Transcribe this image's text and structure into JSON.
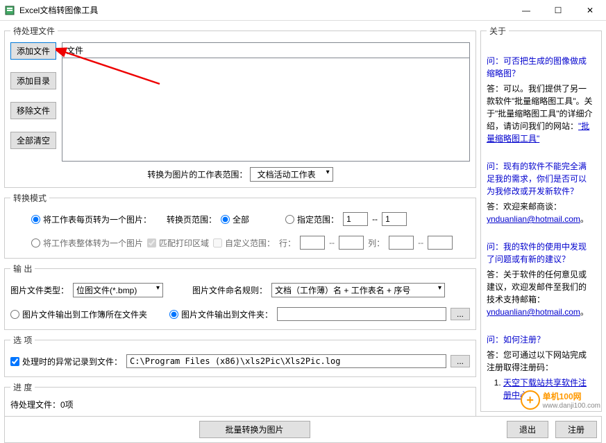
{
  "window": {
    "title": "Excel文档转图像工具",
    "min": "—",
    "max": "☐",
    "close": "✕"
  },
  "pending": {
    "legend": "待处理文件",
    "add_file": "添加文件",
    "add_dir": "添加目录",
    "remove": "移除文件",
    "clear": "全部清空",
    "col_header": "文件",
    "range_label": "转换为图片的工作表范围：",
    "range_select": "文档活动工作表"
  },
  "mode": {
    "legend": "转换模式",
    "each_page": "将工作表每页转为一个图片：",
    "page_range_label": "转换页范围：",
    "page_all": "全部",
    "page_range": "指定范围：",
    "page_from": "1",
    "page_sep": "--",
    "page_to": "1",
    "whole_sheet": "将工作表整体转为一个图片",
    "match_print": "匹配打印区域",
    "custom_range": "自定义范围：",
    "row_label": "行：",
    "col_label": "列：",
    "dash": "--"
  },
  "output": {
    "legend": "输 出",
    "type_label": "图片文件类型：",
    "type_select": "位图文件(*.bmp)",
    "naming_label": "图片文件命名规则：",
    "naming_select": "文档（工作薄）名 + 工作表名 + 序号",
    "to_workbook_dir": "图片文件输出到工作簿所在文件夹",
    "to_folder": "图片文件输出到文件夹：",
    "folder_path": "",
    "browse": "..."
  },
  "options": {
    "legend": "选  项",
    "log_label": "处理时的异常记录到文件：",
    "log_path": "C:\\Program Files (x86)\\xls2Pic\\Xls2Pic.log",
    "browse": "..."
  },
  "progress": {
    "legend": "进  度",
    "text": "待处理文件：0项"
  },
  "bottom": {
    "convert": "批量转换为图片",
    "exit": "退出",
    "register": "注册"
  },
  "about": {
    "legend": "关于",
    "q1": "问：可否把生成的图像做成缩略图？",
    "a1_pre": "答：可以。我们提供了另一款软件\"批量缩略图工具\"。关于\"批量缩略图工具\"的详细介绍，请访问我们的网站：",
    "a1_link": "\"批量缩略图工具\"",
    "q2": "问：现有的软件不能完全满足我的需求，你们是否可以为我修改或开发新软件？",
    "a2_pre": "答：欢迎来邮商谈：",
    "a2_link": "ynduanlian@hotmail.com",
    "a2_post": "。",
    "q3": "问：我的软件的使用中发现了问题或有新的建议？",
    "a3_pre": "答：关于软件的任何意见或建议，欢迎发邮件至我们的技术支持邮箱：",
    "a3_link": "ynduanlian@hotmail.com",
    "a3_post": "。",
    "q4": "问：如何注册？",
    "a4": "答：您可通过以下网站完成注册取得注册码：",
    "list1": "天空下载站共享软件注册中心"
  },
  "watermark": {
    "plus": "+",
    "name": "单机100网",
    "url": "www.danji100.com"
  }
}
